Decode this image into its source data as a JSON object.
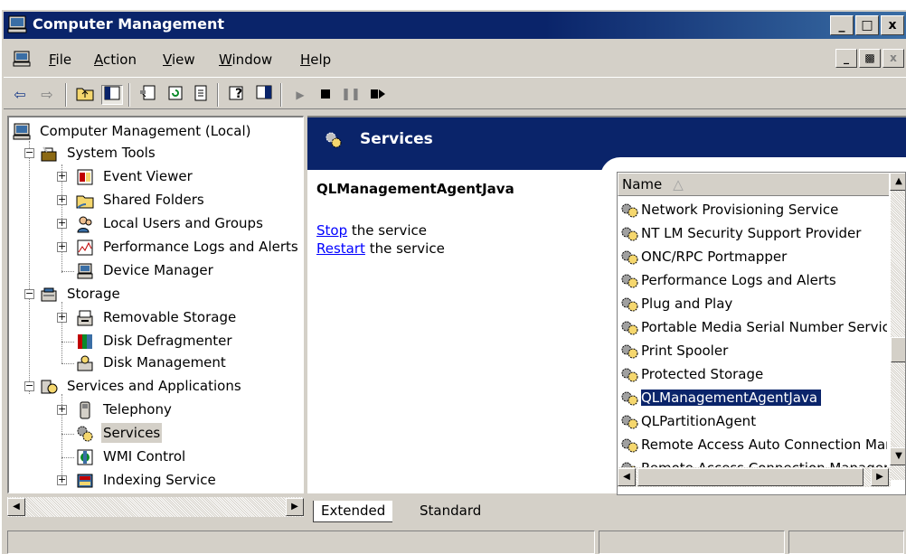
{
  "window": {
    "title": "Computer Management"
  },
  "caption_buttons": [
    "_",
    "□",
    "x"
  ],
  "menu": {
    "items": [
      {
        "label": "File"
      },
      {
        "label": "Action"
      },
      {
        "label": "View"
      },
      {
        "label": "Window"
      },
      {
        "label": "Help"
      }
    ],
    "mdi_buttons": [
      "_",
      "ɸ",
      "x"
    ]
  },
  "toolbar": {
    "buttons": [
      "back",
      "forward",
      "up-folder",
      "show-hide-tree",
      "properties",
      "refresh",
      "export-list",
      "help",
      "show-hide-action-pane",
      "play",
      "stop",
      "pause",
      "restart"
    ]
  },
  "tree": {
    "root": "Computer Management (Local)",
    "system_tools": "System Tools",
    "event_viewer": "Event Viewer",
    "shared_folders": "Shared Folders",
    "local_users": "Local Users and Groups",
    "perf_logs": "Performance Logs and Alerts",
    "device_manager": "Device Manager",
    "storage": "Storage",
    "removable_storage": "Removable Storage",
    "disk_defrag": "Disk Defragmenter",
    "disk_management": "Disk Management",
    "services_apps": "Services and Applications",
    "telephony": "Telephony",
    "services": "Services",
    "wmi_control": "WMI Control",
    "indexing_service": "Indexing Service"
  },
  "details": {
    "header": "Services",
    "service_name": "QLManagementAgentJava",
    "stop_link": "Stop",
    "stop_rest": " the service",
    "restart_link": "Restart",
    "restart_rest": " the service"
  },
  "list": {
    "column": "Name",
    "rows": [
      "Network Provisioning Service",
      "NT LM Security Support Provider",
      "ONC/RPC Portmapper",
      "Performance Logs and Alerts",
      "Plug and Play",
      "Portable Media Serial Number Service",
      "Print Spooler",
      "Protected Storage",
      "QLManagementAgentJava",
      "QLPartitionAgent",
      "Remote Access Auto Connection Manager",
      "Remote Access Connection Manager"
    ],
    "selected_index": 8
  },
  "tabs": [
    {
      "label": "Extended"
    },
    {
      "label": "Standard"
    }
  ]
}
